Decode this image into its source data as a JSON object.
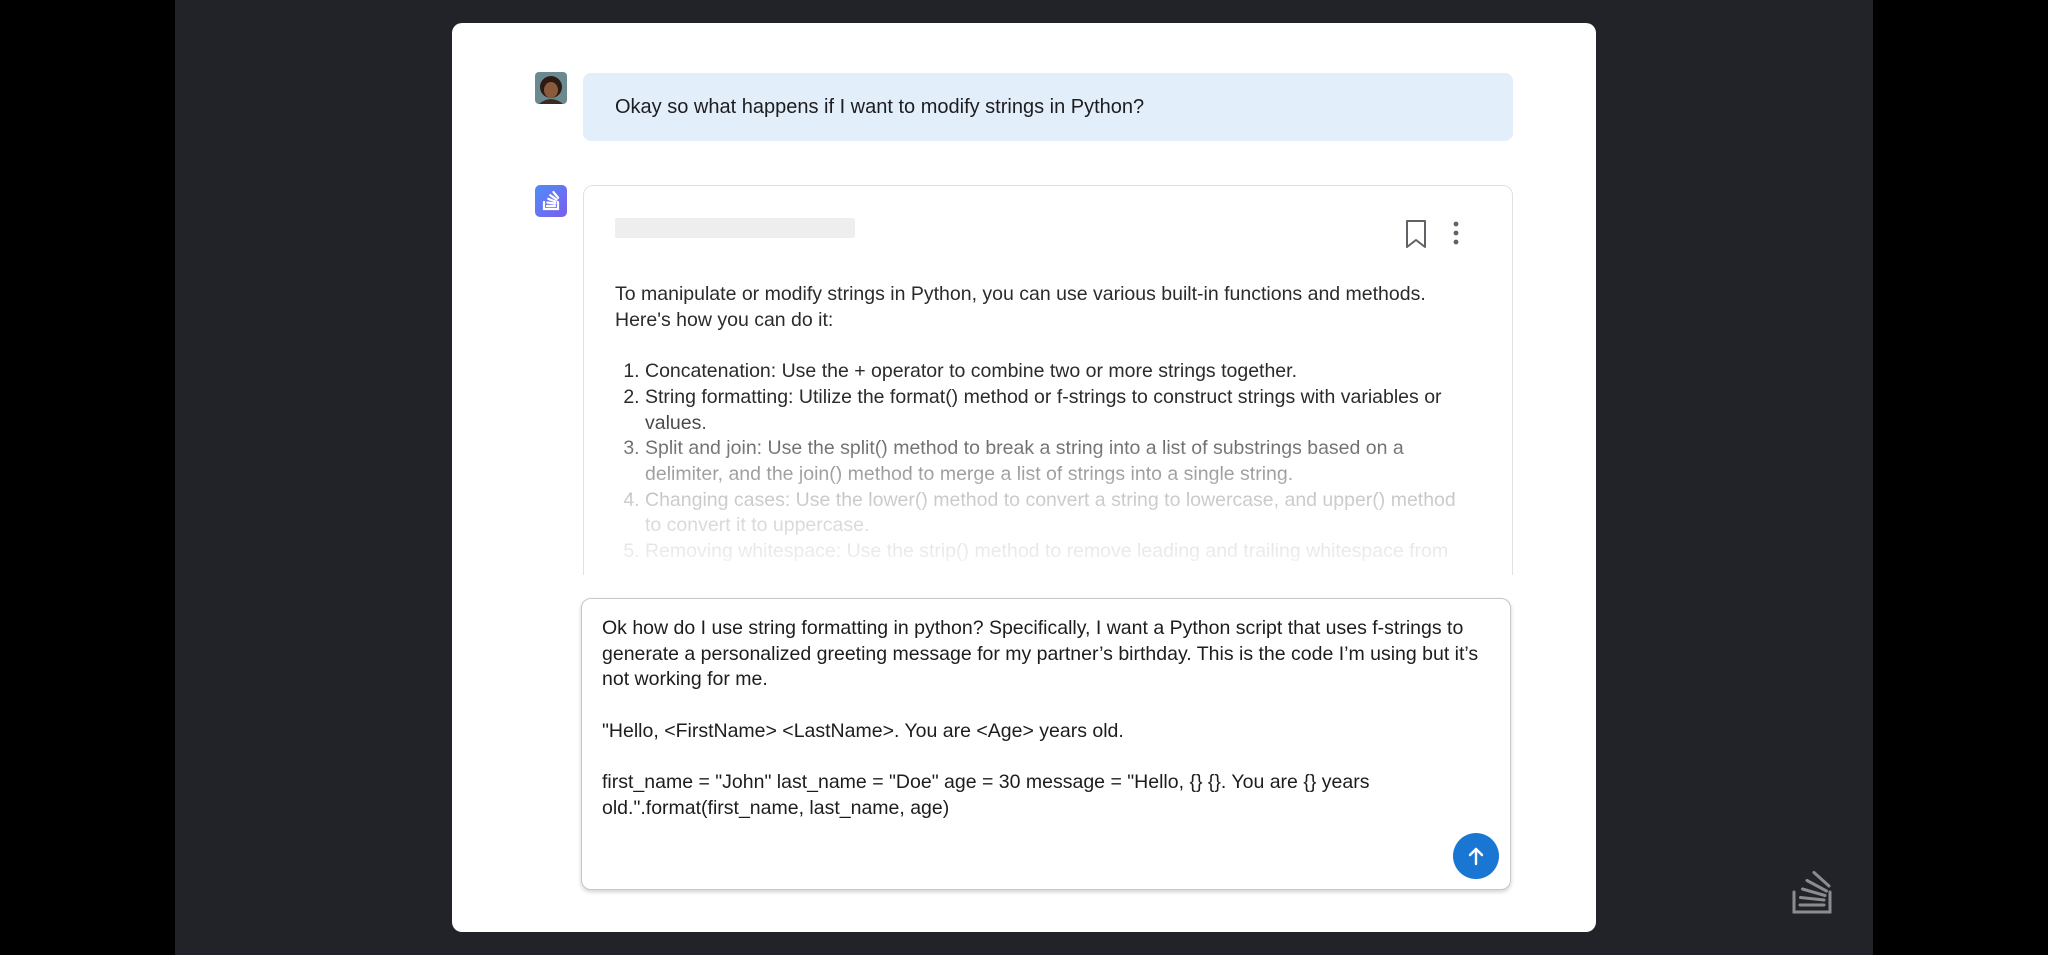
{
  "conversation": {
    "user_message": "Okay so what happens if I want to modify strings in Python?",
    "assistant": {
      "intro": "To manipulate or modify strings in Python, you can use various built-in functions and methods. Here's how you can do it:",
      "items": [
        "Concatenation: Use the + operator to combine two or more strings together.",
        "String formatting: Utilize the format() method or f-strings to construct strings with variables or values.",
        "Split and join: Use the split() method to break a string into a list of substrings based on a delimiter, and the join() method to merge a list of strings into a single string.",
        "Changing cases: Use the lower() method to convert a string to lowercase, and upper() method to convert it to uppercase.",
        "Removing whitespace: Use the strip() method to remove leading and trailing whitespace from"
      ]
    }
  },
  "composer": {
    "paragraph_1": "Ok how do I use string formatting in python? Specifically, I want a Python script that uses f-strings to generate a personalized greeting message for my partner’s birthday. This is the code I’m using but it’s not working for me.",
    "paragraph_2": "\"Hello, <FirstName> <LastName>. You are <Age> years old.",
    "paragraph_3": "first_name = \"John\" last_name = \"Doe\" age = 30 message = \"Hello, {} {}. You are {} years old.\".format(first_name, last_name, age)"
  },
  "icons": {
    "user_avatar": "user-avatar",
    "assistant_logo": "stack-logo-icon",
    "bookmark": "bookmark-icon",
    "more": "more-vertical-icon",
    "send": "arrow-up-icon",
    "watermark": "stack-logo-icon"
  },
  "colors": {
    "background": "#212328",
    "card": "#ffffff",
    "user_bubble": "#e3eefb",
    "send_button": "#1976d2",
    "accent_gradient_start": "#4f8df5",
    "accent_gradient_end": "#7b5cf0"
  }
}
